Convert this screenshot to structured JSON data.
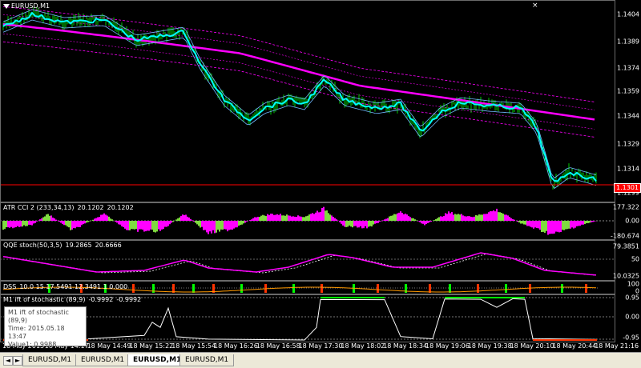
{
  "window": {
    "symbol_title": "EURUSD,M1"
  },
  "main": {
    "price_labels": [
      "1.1404",
      "1.1389",
      "1.1374",
      "1.1359",
      "1.1344",
      "1.1329",
      "1.1314",
      "1.1299"
    ],
    "current_price": "1.1301",
    "close_btn": "×"
  },
  "atr_cci": {
    "title": "ATR CCI 2 (233,34,13)",
    "v1": "20.1202",
    "v2": "20.1202",
    "axis_labels": [
      "177.322",
      "0.00",
      "-180.674"
    ]
  },
  "qqe": {
    "title": "QQE stoch(50,3,5)",
    "v1": "19.2865",
    "v2": "20.6666",
    "axis_labels": [
      "79.3851",
      "50",
      "10.0325"
    ]
  },
  "dss": {
    "title": "DSS",
    "values": "10.0 15  17.5491 12.3491 1 0.000",
    "axis_labels": [
      "100",
      "0"
    ]
  },
  "ift": {
    "title": "M1 ift of stochastic (89,9)",
    "v1": "-0.9992",
    "v2": "-0.9992",
    "axis_labels": [
      "0.95",
      "0.00",
      "-0.95"
    ]
  },
  "tooltip": {
    "line1": "M1 ift of stochastic",
    "line2": "(89,9)",
    "line3": "Time: 2015.05.18 13:47",
    "line4": "Value1: 0.9988"
  },
  "time_labels": [
    "18 May 2015",
    "18 May 14:17",
    "18 May 14:49",
    "18 May 15:22",
    "18 May 15:54",
    "18 May 16:26",
    "18 May 16:58",
    "18 May 17:30",
    "18 May 18:02",
    "18 May 18:34",
    "18 May 19:06",
    "18 May 19:38",
    "18 May 20:10",
    "18 May 20:44",
    "18 May 21:16"
  ],
  "tabs": [
    {
      "label": "EURUSD,M1",
      "active": false
    },
    {
      "label": "EURUSD,M1",
      "active": false
    },
    {
      "label": "EURUSD,M1",
      "active": true
    },
    {
      "label": "EURUSD,M1",
      "active": false
    }
  ],
  "nav": {
    "left": "◄",
    "right": "►"
  },
  "colors": {
    "price_bull": "#00cc00",
    "ma_cyan": "#00ffff",
    "ma_magenta": "#ff00ff",
    "ma_thin": "#6fb8ff",
    "price_line": "#ff0000",
    "hist_magenta": "#ff00ff",
    "hist_green": "#7fdb3f",
    "qqe_line": "#ff00ff",
    "ift_line": "#ffffff",
    "ift_high": "#00ff00",
    "ift_low": "#ff3300"
  }
}
